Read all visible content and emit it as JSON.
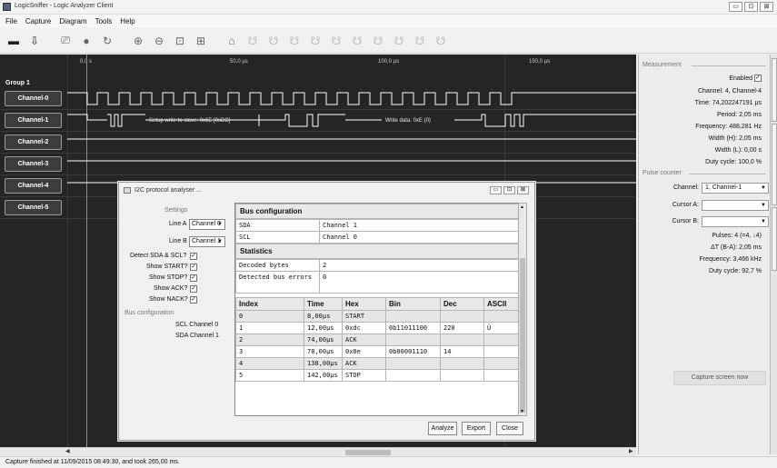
{
  "window": {
    "title": "LogicSniffer - Logic Analyzer Client",
    "min": "▭",
    "restore": "⊡",
    "close": "⊠"
  },
  "menu": [
    "File",
    "Capture",
    "Diagram",
    "Tools",
    "Help"
  ],
  "ruler": {
    "t0": "0,0 s",
    "t1": "50,0 µs",
    "t2": "100,0 µs",
    "t3": "150,0 µs"
  },
  "group": "Group 1",
  "channels": [
    "Channel-0",
    "Channel-1",
    "Channel-2",
    "Channel-3",
    "Channel-4",
    "Channel-5"
  ],
  "annotations": {
    "a1": "Setup write to slave: 0x6E [0xDC]",
    "a2": "Write data: 0xE (0)"
  },
  "status": "Capture finished at 11/09/2015 08:49:30, and took 265,00 ms.",
  "measurement": {
    "title": "Measurement",
    "enabled_label": "Enabled",
    "channel": "Channel: 4, Channel-4",
    "time": "Time: 74,202247191 µs",
    "period": "Period: 2,05 ms",
    "frequency": "Frequency: 488,281 Hz",
    "width_h": "Width (H): 2,05 ms",
    "width_l": "Width (L): 0,00 s",
    "duty": "Duty cycle: 100,0 %"
  },
  "pulse": {
    "title": "Pulse counter",
    "channel_label": "Channel:",
    "channel_value": "1, Channel-1",
    "cursor_a": "Cursor A:",
    "cursor_b": "Cursor B:",
    "pulses": "Pulses: 4 (=4, ↓4)",
    "delta_t": "ΔT (B-A): 2,05 ms",
    "frequency": "Frequency: 3,466 kHz",
    "duty": "Duty cycle: 92,7 %"
  },
  "capture_button": "Capture screen now",
  "dialog": {
    "title": "I2C protocol analyser ...",
    "settings": "Settings",
    "line_a": "Line A",
    "line_a_value": "Channel 0",
    "line_b": "Line B",
    "line_b_value": "Channel 1",
    "detect": "Detect SDA & SCL?",
    "show_start": "Show START?",
    "show_stop": "Show STOP?",
    "show_ack": "Show ACK?",
    "show_nack": "Show NACK?",
    "bus_config": "Bus configuration",
    "scl_info": "SCL Channel 0",
    "sda_info": "SDA Channel 1",
    "bus_config_header": "Bus configuration",
    "bus_rows": [
      [
        "SDA",
        "Channel 1"
      ],
      [
        "SCL",
        "Channel 0"
      ]
    ],
    "statistics_header": "Statistics",
    "stat_rows": [
      [
        "Decoded bytes",
        "2"
      ],
      [
        "Detected bus errors",
        "0"
      ]
    ],
    "columns": [
      "Index",
      "Time",
      "Hex",
      "Bin",
      "Dec",
      "ASCII"
    ],
    "rows": [
      [
        "0",
        "8,00µs",
        "START",
        "",
        "",
        ""
      ],
      [
        "1",
        "12,00µs",
        "0xdc",
        "0b11011100",
        "220",
        "Ü"
      ],
      [
        "2",
        "74,00µs",
        "ACK",
        "",
        "",
        ""
      ],
      [
        "3",
        "78,00µs",
        "0x0e",
        "0b00001110",
        "14",
        ""
      ],
      [
        "4",
        "138,00µs",
        "ACK",
        "",
        "",
        ""
      ],
      [
        "5",
        "142,00µs",
        "STOP",
        "",
        "",
        ""
      ]
    ],
    "analyze": "Analyze",
    "export": "Export",
    "close": "Close"
  }
}
